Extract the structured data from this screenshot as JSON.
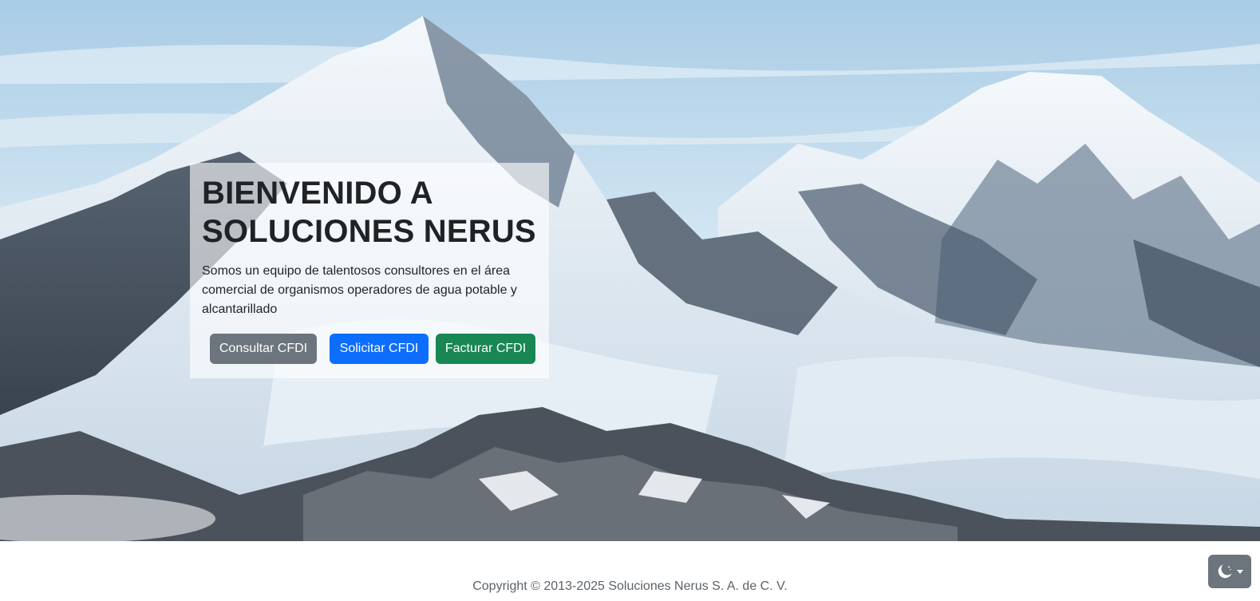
{
  "hero": {
    "title_line1": "BIENVENIDO A",
    "title_line2": "SOLUCIONES NERUS",
    "description": "Somos un equipo de talentosos consultores en el área comercial de organismos operadores de agua potable y alcantarillado"
  },
  "actions": {
    "consultar_label": "Consultar CFDI",
    "solicitar_label": "Solicitar CFDI",
    "facturar_label": "Facturar CFDI"
  },
  "footer": {
    "copyright": "Copyright © 2013-2025 Soluciones Nerus S. A. de C. V."
  },
  "theme_toggle": {
    "icon": "moon-icon",
    "caret_icon": "caret-down-icon"
  },
  "colors": {
    "secondary": "#6c757d",
    "primary": "#0d6efd",
    "success": "#198754"
  }
}
